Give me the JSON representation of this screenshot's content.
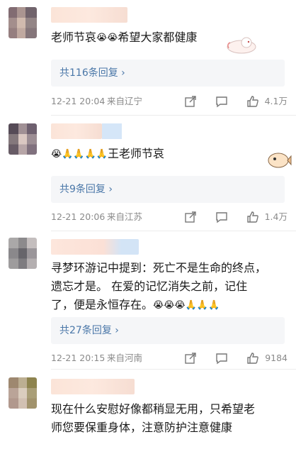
{
  "comments": [
    {
      "text": "老师节哀",
      "emojis": "😭😭",
      "text2": "希望大家都健康",
      "reply_label": "共116条回复 ›",
      "time": "12-21 20:04",
      "location": "来自辽宁",
      "likes": "4.1万"
    },
    {
      "emojis": "😭🙏🙏🙏🙏",
      "text": "王老师节哀",
      "reply_label": "共9条回复 ›",
      "time": "12-21 20:06",
      "location": "来自江苏",
      "likes": "1.4万"
    },
    {
      "line1": "寻梦环游记中提到：死亡不是生命的终点，",
      "line2": "遗忘才是。 在爱的记忆消失之前，记住",
      "line3": "了，便是永恒存在。",
      "emojis": "😭😭😭🙏🙏🙏",
      "reply_label": "共27条回复 ›",
      "time": "12-21 20:15",
      "location": "来自河南",
      "likes": "9184"
    },
    {
      "line1": "现在什么安慰好像都稍显无用，只希望老",
      "line2": "师您要保重身体，注意防护注意健康"
    }
  ],
  "icons": {
    "share": "share-icon",
    "comment": "comment-icon",
    "like": "thumbs-up-icon"
  }
}
